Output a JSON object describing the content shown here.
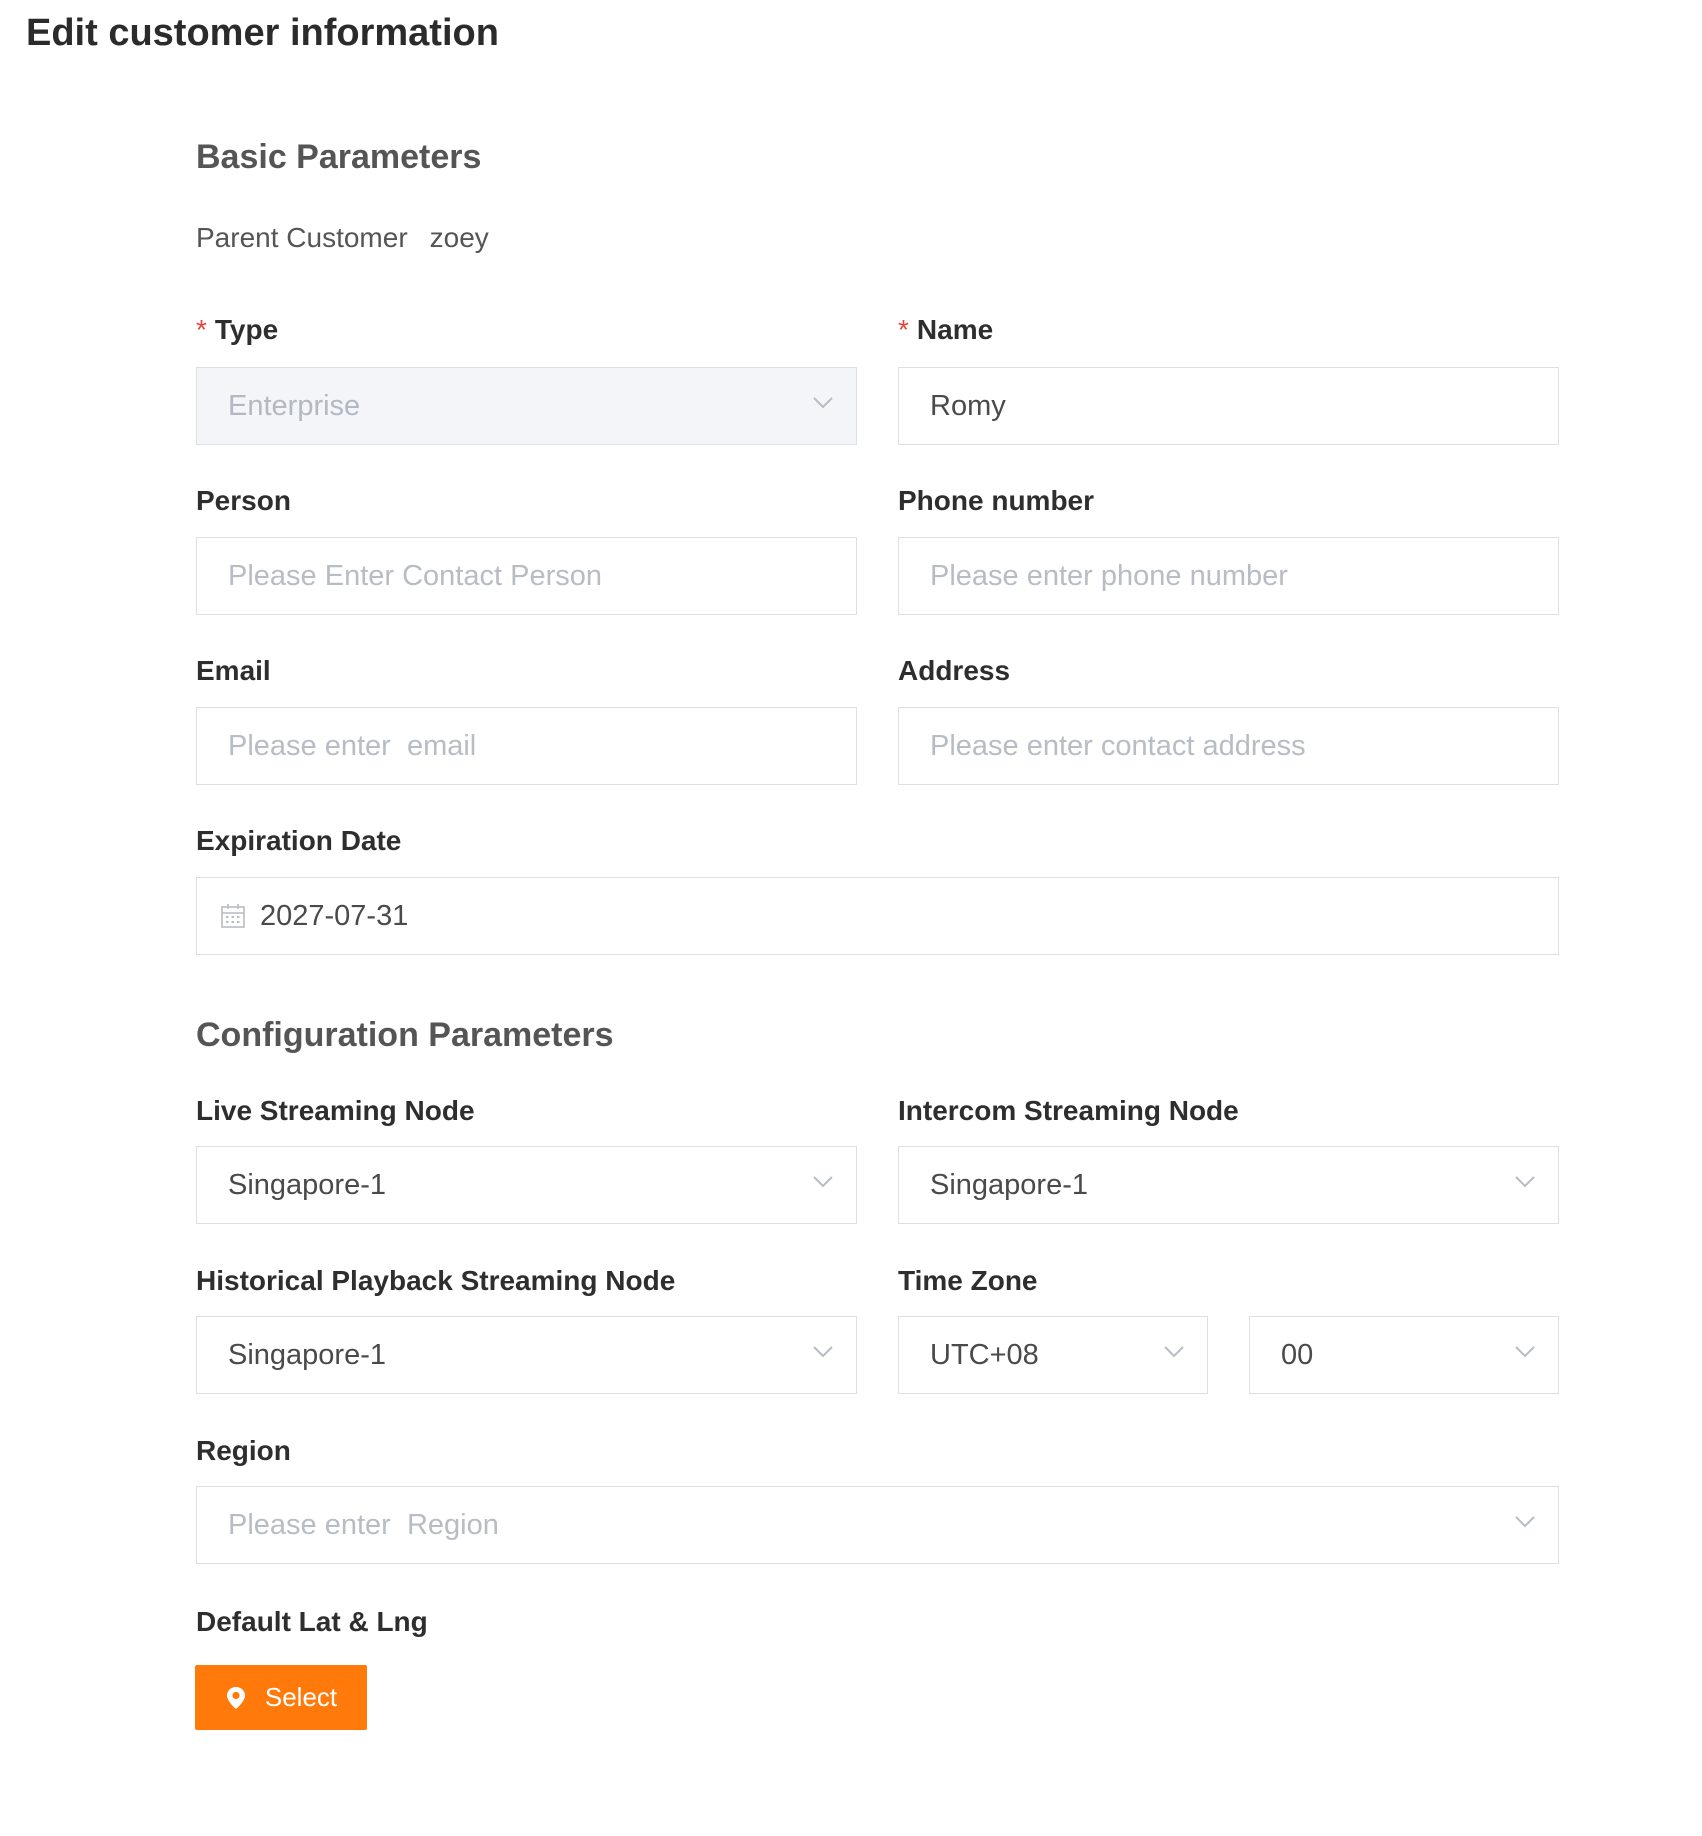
{
  "page": {
    "title": "Edit customer information"
  },
  "basic": {
    "title": "Basic Parameters",
    "parent_label": "Parent Customer",
    "parent_value": "zoey",
    "required_mark": "*",
    "type": {
      "label": "Type",
      "value": "Enterprise",
      "disabled": true
    },
    "name": {
      "label": "Name",
      "value": "Romy"
    },
    "person": {
      "label": "Person",
      "placeholder": "Please Enter Contact Person"
    },
    "phone": {
      "label": "Phone number",
      "placeholder": "Please enter phone number"
    },
    "email": {
      "label": "Email",
      "placeholder": "Please enter  email"
    },
    "address": {
      "label": "Address",
      "placeholder": "Please enter contact address"
    },
    "expiration": {
      "label": "Expiration Date",
      "value": "2027-07-31",
      "icon": "calendar-icon"
    }
  },
  "config": {
    "title": "Configuration Parameters",
    "live_node": {
      "label": "Live Streaming Node",
      "value": "Singapore-1"
    },
    "intercom_node": {
      "label": "Intercom Streaming Node",
      "value": "Singapore-1"
    },
    "playback_node": {
      "label": "Historical Playback Streaming Node",
      "value": "Singapore-1"
    },
    "timezone": {
      "label": "Time Zone",
      "hour": "UTC+08",
      "minute": "00"
    },
    "region": {
      "label": "Region",
      "placeholder": "Please enter  Region"
    },
    "latlng": {
      "label": "Default Lat & Lng",
      "button_label": "Select",
      "icon": "map-pin-icon"
    }
  },
  "colors": {
    "accent": "#ff7a0a",
    "required": "#e8443a",
    "border": "#dcdfe6",
    "disabled_bg": "#f3f5f9"
  }
}
